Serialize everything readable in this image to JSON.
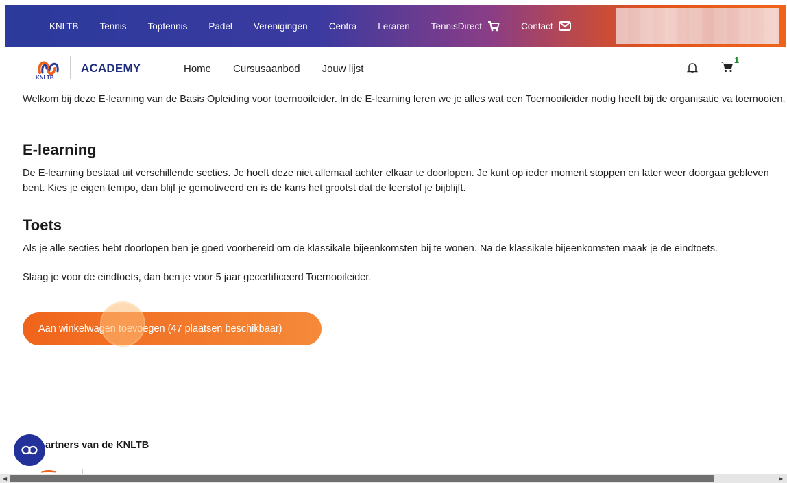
{
  "topnav": {
    "items": [
      "KNLTB",
      "Tennis",
      "Toptennis",
      "Padel",
      "Verenigingen",
      "Centra",
      "Leraren",
      "TennisDirect",
      "Contact"
    ]
  },
  "subnav": {
    "logo_text": "KNLTB",
    "academy": "ACADEMY",
    "links": [
      "Home",
      "Cursusaanbod",
      "Jouw lijst"
    ],
    "cart_count": "1"
  },
  "content": {
    "intro": "Welkom bij deze E-learning van de Basis Opleiding voor toernooileider. In de E-learning leren we je alles wat een Toernooileider nodig heeft bij de organisatie va toernooien.",
    "elearning_heading": "E-learning",
    "elearning_text": "De E-learning bestaat uit verschillende secties. Je hoeft deze niet allemaal achter elkaar te doorlopen. Je kunt op ieder moment stoppen en later weer doorgaa gebleven bent. Kies je eigen tempo, dan blijf je gemotiveerd en is de kans het grootst dat de leerstof je bijblijft.",
    "toets_heading": "Toets",
    "toets_text": "Als je alle secties hebt doorlopen ben je goed voorbereid om de klassikale bijeenkomsten bij te wonen. Na de klassikale bijeenkomsten maak je de eindtoets.",
    "slaag_text": "Slaag je voor de eindtoets, dan ben je voor 5 jaar gecertificeerd Toernooileider.",
    "cta_label": "Aan winkelwagen toevoegen (47 plaatsen beschikbaar)"
  },
  "footer": {
    "partners_heading": "artners van de KNLTB"
  },
  "colors": {
    "brand_blue": "#2b3a9c",
    "brand_orange": "#f0641a",
    "cart_badge": "#1a8a2a"
  },
  "icons": [
    "cart-icon",
    "mail-icon",
    "bell-icon",
    "shopping-cart-icon",
    "link-icon"
  ]
}
